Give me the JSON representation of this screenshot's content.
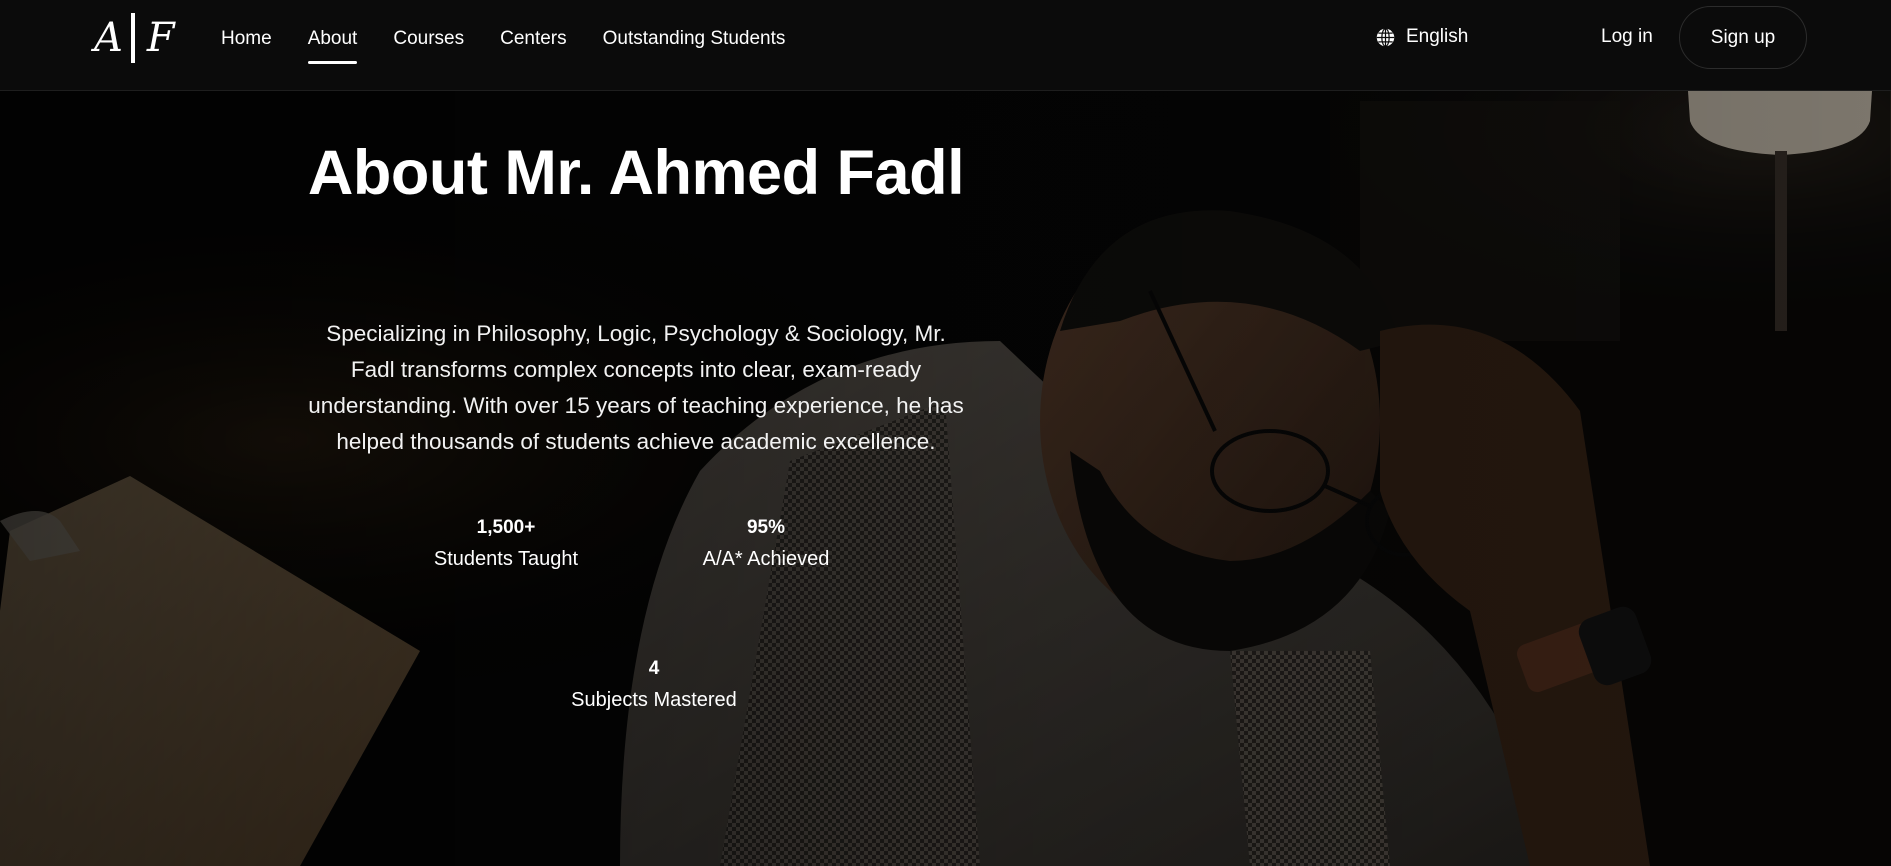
{
  "header": {
    "logo_left": "A",
    "logo_right": "F",
    "nav": [
      {
        "label": "Home"
      },
      {
        "label": "About",
        "active": true
      },
      {
        "label": "Courses"
      },
      {
        "label": "Centers"
      },
      {
        "label": "Outstanding Students"
      }
    ],
    "language": {
      "label": "English",
      "icon": "globe-icon"
    },
    "login_label": "Log in",
    "signup_label": "Sign up"
  },
  "hero": {
    "title": "About Mr. Ahmed Fadl",
    "description": "Specializing in Philosophy, Logic, Psychology & Sociology, Mr. Fadl transforms complex concepts into clear, exam-ready understanding. With over 15 years of teaching experience, he has helped thousands of students achieve academic excellence.",
    "stats": [
      {
        "value": "1,500+",
        "label": "Students Taught"
      },
      {
        "value": "95%",
        "label": "A/A* Achieved"
      },
      {
        "value": "4",
        "label": "Subjects Mastered"
      }
    ]
  },
  "colors": {
    "background": "#0a0a0a",
    "text": "#ffffff",
    "accent": "#ffffff"
  }
}
